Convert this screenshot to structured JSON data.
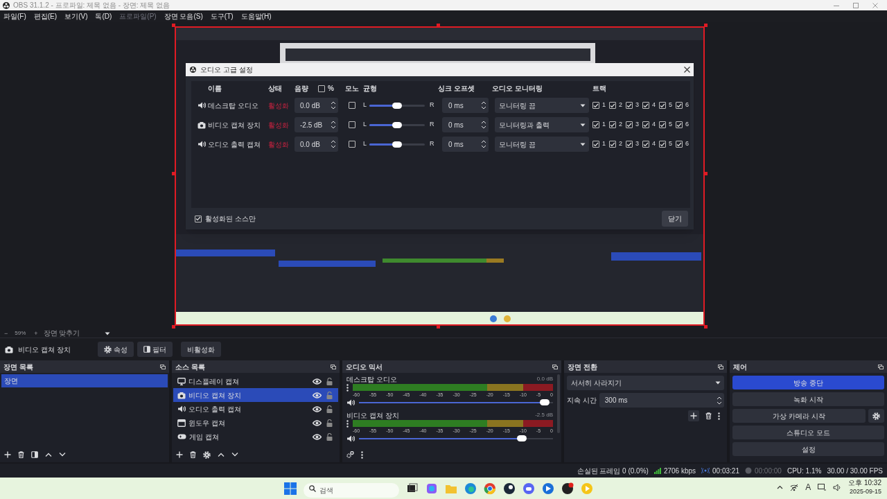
{
  "window": {
    "title": "OBS 31.1.2 - 프로파일: 제목 없음 - 장면: 제목 없음"
  },
  "menu": [
    {
      "label": "파일(F)",
      "disabled": false
    },
    {
      "label": "편집(E)",
      "disabled": false
    },
    {
      "label": "보기(V)",
      "disabled": false
    },
    {
      "label": "독(D)",
      "disabled": false
    },
    {
      "label": "프로파일(P)",
      "disabled": true
    },
    {
      "label": "장면 모음(S)",
      "disabled": false
    },
    {
      "label": "도구(T)",
      "disabled": false
    },
    {
      "label": "도움말(H)",
      "disabled": false
    }
  ],
  "dialog": {
    "title": "오디오 고급 설정",
    "columns": [
      "이름",
      "상태",
      "음량",
      "모노",
      "균형",
      "싱크 오프셋",
      "오디오 모니터링",
      "트랙"
    ],
    "percent": {
      "label": "%",
      "checked": false
    },
    "rows": [
      {
        "kind": "speaker",
        "name": "데스크탑 오디오",
        "status": "활성화",
        "volume": "0.0 dB",
        "mono": false,
        "left": "L",
        "right": "R",
        "level": 0.5,
        "sync": "0 ms",
        "monitoring": "모니터링 끔",
        "tracks": [
          {
            "label": "1",
            "checked": true
          },
          {
            "label": "2",
            "checked": true
          },
          {
            "label": "3",
            "checked": true
          },
          {
            "label": "4",
            "checked": true
          },
          {
            "label": "5",
            "checked": true
          },
          {
            "label": "6",
            "checked": true
          }
        ]
      },
      {
        "kind": "camera",
        "name": "비디오 캡쳐 장치",
        "status": "활성화",
        "volume": "-2.5 dB",
        "mono": false,
        "left": "L",
        "right": "R",
        "level": 0.5,
        "sync": "0 ms",
        "monitoring": "모니터링과 출력",
        "tracks": [
          {
            "label": "1",
            "checked": true
          },
          {
            "label": "2",
            "checked": true
          },
          {
            "label": "3",
            "checked": true
          },
          {
            "label": "4",
            "checked": true
          },
          {
            "label": "5",
            "checked": true
          },
          {
            "label": "6",
            "checked": true
          }
        ]
      },
      {
        "kind": "speaker",
        "name": "오디오 출력 캡쳐",
        "status": "활성화",
        "volume": "0.0 dB",
        "mono": false,
        "left": "L",
        "right": "R",
        "level": 0.5,
        "sync": "0 ms",
        "monitoring": "모니터링 끔",
        "tracks": [
          {
            "label": "1",
            "checked": true
          },
          {
            "label": "2",
            "checked": true
          },
          {
            "label": "3",
            "checked": true
          },
          {
            "label": "4",
            "checked": true
          },
          {
            "label": "5",
            "checked": true
          },
          {
            "label": "6",
            "checked": true
          }
        ]
      }
    ],
    "active_only": {
      "label": "활성화된 소스만",
      "checked": true
    },
    "close": "닫기"
  },
  "zoom_bar": {
    "minus": "−",
    "zoom": "59%",
    "plus": "+",
    "fit": "장면 맞추기"
  },
  "source_toolbar": {
    "source": "비디오 캡쳐 장치",
    "buttons": [
      {
        "kind": "gear",
        "label": "속성"
      },
      {
        "kind": "filter",
        "label": "필터"
      },
      {
        "kind": "plain",
        "label": "비활성화"
      }
    ]
  },
  "scenes": {
    "title": "장면 목록",
    "items": [
      {
        "label": "장면",
        "selected": true
      }
    ]
  },
  "sources": {
    "title": "소스 목록",
    "items": [
      {
        "kind": "display",
        "label": "디스플레이 캡쳐",
        "selected": false,
        "visible": true,
        "locked": false
      },
      {
        "kind": "camera",
        "label": "비디오 캡쳐 장치",
        "selected": true,
        "visible": true,
        "locked": false
      },
      {
        "kind": "speaker",
        "label": "오디오 출력 캡쳐",
        "selected": false,
        "visible": true,
        "locked": false
      },
      {
        "kind": "window",
        "label": "윈도우 캡쳐",
        "selected": false,
        "visible": true,
        "locked": false
      },
      {
        "kind": "gamepad",
        "label": "게임 캡쳐",
        "selected": false,
        "visible": true,
        "locked": false
      }
    ]
  },
  "mixer": {
    "title": "오디오 믹서",
    "channels": [
      {
        "name": "데스크탑 오디오",
        "reading": "0.0 dB",
        "level": 0.98,
        "ticks": [
          "-60",
          "-55",
          "-50",
          "-45",
          "-40",
          "-35",
          "-30",
          "-25",
          "-20",
          "-15",
          "-10",
          "-5",
          "0"
        ]
      },
      {
        "name": "비디오 캡쳐 장치",
        "reading": "-2.5 dB",
        "level": 0.86,
        "ticks": [
          "-60",
          "-55",
          "-50",
          "-45",
          "-40",
          "-35",
          "-30",
          "-25",
          "-20",
          "-15",
          "-10",
          "-5",
          "0"
        ]
      }
    ]
  },
  "transitions": {
    "title": "장면 전환",
    "transition": "서서히 사라지기",
    "duration_label": "지속 시간",
    "duration": "300 ms"
  },
  "controls": {
    "title": "제어",
    "buttons": [
      {
        "label": "방송 중단",
        "active": true,
        "settings": false
      },
      {
        "label": "녹화 시작",
        "active": false,
        "settings": false
      },
      {
        "label": "가상 카메라 시작",
        "active": false,
        "settings": true
      },
      {
        "label": "스튜디오 모드",
        "active": false,
        "settings": false
      },
      {
        "label": "설정",
        "active": false,
        "settings": false
      }
    ]
  },
  "status_bar": {
    "dropped": "손실된 프레임 0 (0.0%)",
    "bitrate": "2706 kbps",
    "stream_time": "00:03:21",
    "record_time": "00:00:00",
    "cpu": "CPU: 1.1%",
    "fps": "30.00 / 30.00 FPS"
  },
  "taskbar": {
    "search_placeholder": "검색",
    "ime": "A",
    "time": "오후 10:32",
    "date": "2025-09-15"
  }
}
